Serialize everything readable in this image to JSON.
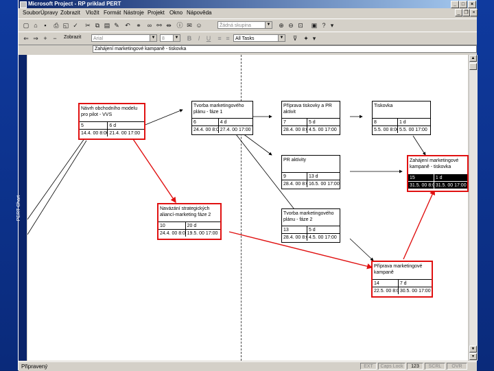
{
  "title": "Microsoft Project - RP priklad PERT",
  "menu": [
    "Soubor",
    "Úpravy",
    "Zobrazit",
    "Vložit",
    "Formát",
    "Nástroje",
    "Projekt",
    "Okno",
    "Nápověda"
  ],
  "toolbar": {
    "group_combo": "Žádná skupina"
  },
  "format_bar": {
    "show_label": "Zobrazit",
    "font": "Arial",
    "size": "8",
    "bold": "B",
    "italic": "I",
    "underline": "U",
    "filter": "All Tasks"
  },
  "entry_text": "Zahájení marketingové kampaně - tiskovka",
  "view_label": "PERT Chart",
  "status": {
    "ready": "Připravený",
    "panels": [
      "EXT",
      "Caps Lock",
      "123",
      "SCRL",
      "OVR"
    ]
  },
  "nodes": [
    {
      "id": "n1",
      "name": "Návrh obchodního modelu pro pilot - VVS",
      "num": "5",
      "dur": "6 d",
      "start": "14.4. 00 8:00",
      "finish": "21.4. 00 17:00",
      "critical": true
    },
    {
      "id": "n2",
      "name": "Tvorba marketingového plánu - fáze 1",
      "num": "6",
      "dur": "4 d",
      "start": "24.4. 00 8:00",
      "finish": "27.4. 00 17:00",
      "critical": false
    },
    {
      "id": "n3",
      "name": "Příprava tiskovky a PR aktivit",
      "num": "7",
      "dur": "5 d",
      "start": "28.4. 00 8:00",
      "finish": "4.5. 00 17:00",
      "critical": false
    },
    {
      "id": "n4",
      "name": "Tiskovka",
      "num": "8",
      "dur": "1 d",
      "start": "5.5. 00 8:00",
      "finish": "5.5. 00 17:00",
      "critical": false
    },
    {
      "id": "n5",
      "name": "PR aktivity",
      "num": "9",
      "dur": "13 d",
      "start": "28.4. 00 8:00",
      "finish": "16.5. 00 17:00",
      "critical": false
    },
    {
      "id": "n6",
      "name": "Zahájení marketingové kampaně - tiskovka",
      "num": "15",
      "dur": "1 d",
      "start": "31.5. 00 8:00",
      "finish": "31.5. 00 17:00",
      "critical": true
    },
    {
      "id": "n7",
      "name": "Navázání strategických aliancí-marketing fáze 2",
      "num": "10",
      "dur": "20 d",
      "start": "24.4. 00 8:00",
      "finish": "19.5. 00 17:00",
      "critical": true
    },
    {
      "id": "n8",
      "name": "Tvorba marketingového plánu - fáze 2",
      "num": "13",
      "dur": "5 d",
      "start": "28.4. 00 8:00",
      "finish": "4.5. 00 17:00",
      "critical": false
    },
    {
      "id": "n9",
      "name": "Příprava marketingové kampaně",
      "num": "14",
      "dur": "7 d",
      "start": "22.5. 00 8:00",
      "finish": "30.5. 00 17:00",
      "critical": true
    }
  ],
  "colors": {
    "critical": "#e01010",
    "link": "#000000",
    "titlebar": "#0a246a"
  }
}
